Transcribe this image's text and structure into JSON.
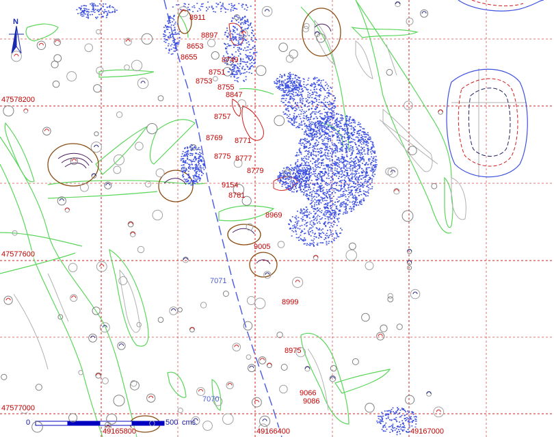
{
  "map": {
    "north_arrow": "N",
    "easting_labels": [
      "49165800",
      "49166400",
      "49167000"
    ],
    "northing_labels": [
      "47578200",
      "47577600",
      "47577000"
    ],
    "route_labels": [
      "7071",
      "7070"
    ],
    "feature_labels": [
      "8911",
      "8897",
      "8653",
      "8655",
      "8749",
      "8751",
      "8753",
      "8755",
      "8847",
      "8757",
      "8769",
      "8771",
      "8775",
      "8777",
      "8779",
      "9154",
      "8781",
      "8969",
      "9005",
      "8999",
      "8975",
      "9066",
      "9086"
    ],
    "scale": {
      "start": "0",
      "end": "500",
      "unit": "cms."
    },
    "colors": {
      "grid": "#d01818",
      "labels": "#c00000",
      "points": "#3b4fe0",
      "vegetation": "#5ad65a",
      "pits": "#8a4a10",
      "route": "#5060e0"
    }
  }
}
